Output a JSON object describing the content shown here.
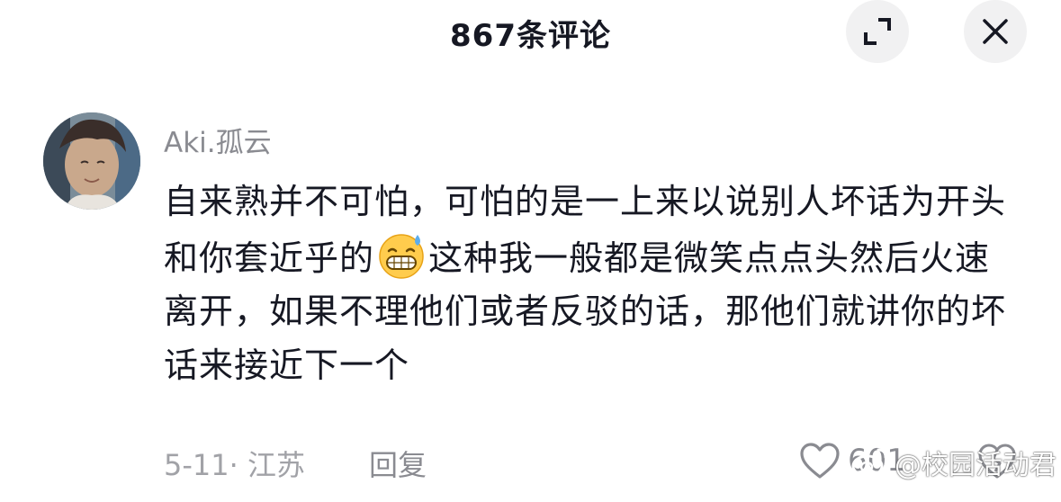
{
  "header": {
    "title": "867条评论",
    "expand_icon": "expand-icon",
    "close_icon": "close-icon"
  },
  "comment": {
    "username": "Aki.孤云",
    "text_part1": "自来熟并不可怕，可怕的是一上来以说别人坏话为开头和你套近乎的",
    "emoji": "grinning-sweat-emoji",
    "text_part2": "这种我一般都是微笑点点头然后火速离开，如果不理他们或者反驳的话，那他们就讲你的坏话来接近下一个",
    "meta": "5-11· 江苏",
    "reply_label": "回复",
    "like_count": "601",
    "like_icon": "heart-icon",
    "dislike_icon": "broken-heart-icon"
  },
  "watermark": {
    "text": "@校园活动君",
    "icon": "weibo-icon"
  },
  "colors": {
    "text": "#161823",
    "secondary": "#8a8b91",
    "button_bg": "#f1f1f2"
  }
}
